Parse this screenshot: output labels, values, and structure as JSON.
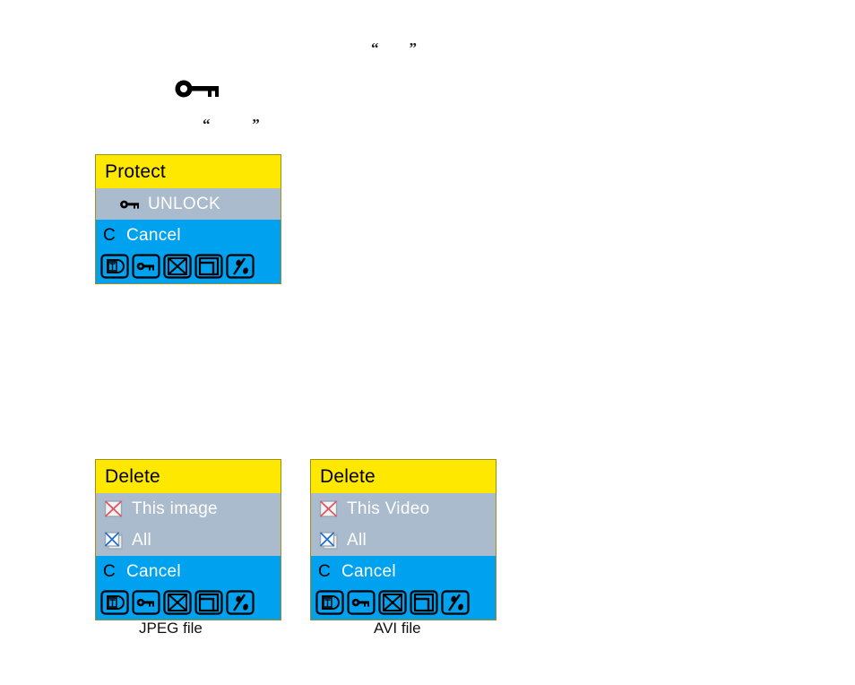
{
  "document": {
    "stray_quotes": [
      {
        "id": "quote-top",
        "text": "“        ”"
      },
      {
        "id": "quote-second",
        "text": "“           ”"
      }
    ],
    "key_glyph_name": "key-icon"
  },
  "protect_menu": {
    "title": "Protect",
    "rows": [
      {
        "marker": "",
        "icon": "key-icon",
        "label": "UNLOCK",
        "state": "highlight"
      },
      {
        "marker": "C",
        "icon": "",
        "label": "Cancel",
        "state": "blue"
      }
    ],
    "toolbar": [
      {
        "name": "text-stamp-icon"
      },
      {
        "name": "key-icon"
      },
      {
        "name": "delete-x-icon"
      },
      {
        "name": "copy-pages-icon"
      },
      {
        "name": "slideshow-icon"
      }
    ]
  },
  "delete_jpeg_menu": {
    "title": "Delete",
    "caption": "JPEG file",
    "rows": [
      {
        "marker": "",
        "icon": "delete-single-icon",
        "label": "This image",
        "state": "highlight"
      },
      {
        "marker": "",
        "icon": "delete-all-icon",
        "label": "All",
        "state": "highlight"
      },
      {
        "marker": "C",
        "icon": "",
        "label": "Cancel",
        "state": "blue"
      }
    ],
    "toolbar": [
      {
        "name": "text-stamp-icon"
      },
      {
        "name": "key-icon"
      },
      {
        "name": "delete-x-icon"
      },
      {
        "name": "copy-pages-icon"
      },
      {
        "name": "slideshow-icon"
      }
    ]
  },
  "delete_avi_menu": {
    "title": "Delete",
    "caption": "AVI file",
    "rows": [
      {
        "marker": "",
        "icon": "delete-single-icon",
        "label": "This Video",
        "state": "highlight"
      },
      {
        "marker": "",
        "icon": "delete-all-icon",
        "label": "All",
        "state": "highlight"
      },
      {
        "marker": "C",
        "icon": "",
        "label": "Cancel",
        "state": "blue"
      }
    ],
    "toolbar": [
      {
        "name": "text-stamp-icon"
      },
      {
        "name": "key-icon"
      },
      {
        "name": "delete-x-icon"
      },
      {
        "name": "copy-pages-icon"
      },
      {
        "name": "slideshow-icon"
      }
    ]
  },
  "colors": {
    "title_bar": "#FFE800",
    "menu_background": "#00A2F0",
    "row_highlight": "#A9BBCC",
    "label_text": "#FFFFFF",
    "delete_single_x": "#E05560",
    "delete_all_x": "#1F6FD0"
  }
}
